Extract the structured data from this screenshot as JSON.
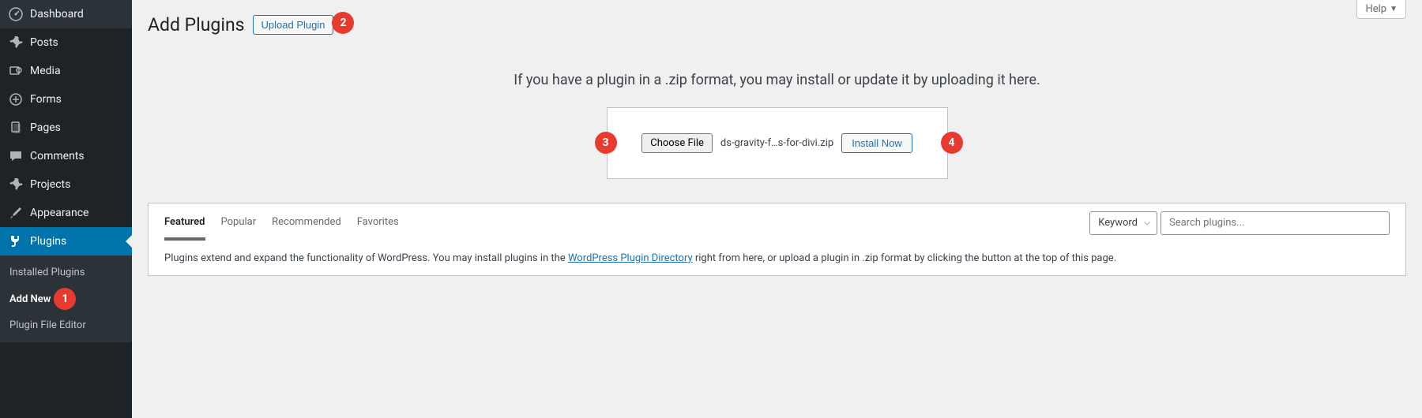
{
  "sidebar": {
    "items": [
      {
        "label": "Dashboard",
        "icon": "dashboard"
      },
      {
        "label": "Posts",
        "icon": "pin"
      },
      {
        "label": "Media",
        "icon": "media"
      },
      {
        "label": "Forms",
        "icon": "form"
      },
      {
        "label": "Pages",
        "icon": "pages"
      },
      {
        "label": "Comments",
        "icon": "comment"
      },
      {
        "label": "Projects",
        "icon": "pin"
      },
      {
        "label": "Appearance",
        "icon": "brush"
      },
      {
        "label": "Plugins",
        "icon": "plug"
      }
    ],
    "submenu": [
      {
        "label": "Installed Plugins"
      },
      {
        "label": "Add New"
      },
      {
        "label": "Plugin File Editor"
      }
    ]
  },
  "header": {
    "title": "Add Plugins",
    "upload_button": "Upload Plugin",
    "help_label": "Help"
  },
  "upload": {
    "instructions": "If you have a plugin in a .zip format, you may install or update it by uploading it here.",
    "choose_file": "Choose File",
    "file_name": "ds-gravity-f…s-for-divi.zip",
    "install_now": "Install Now"
  },
  "tabs": {
    "items": [
      "Featured",
      "Popular",
      "Recommended",
      "Favorites"
    ],
    "active": 0,
    "keyword_label": "Keyword",
    "search_placeholder": "Search plugins..."
  },
  "description": {
    "pre": "Plugins extend and expand the functionality of WordPress. You may install plugins in the ",
    "link": "WordPress Plugin Directory",
    "post": " right from here, or upload a plugin in .zip format by clicking the button at the top of this page."
  },
  "badges": {
    "b1": "1",
    "b2": "2",
    "b3": "3",
    "b4": "4"
  },
  "colors": {
    "accent": "#2271b1",
    "sidebar_bg": "#1d2327",
    "active_bg": "#0073aa",
    "badge": "#e63b2e"
  }
}
